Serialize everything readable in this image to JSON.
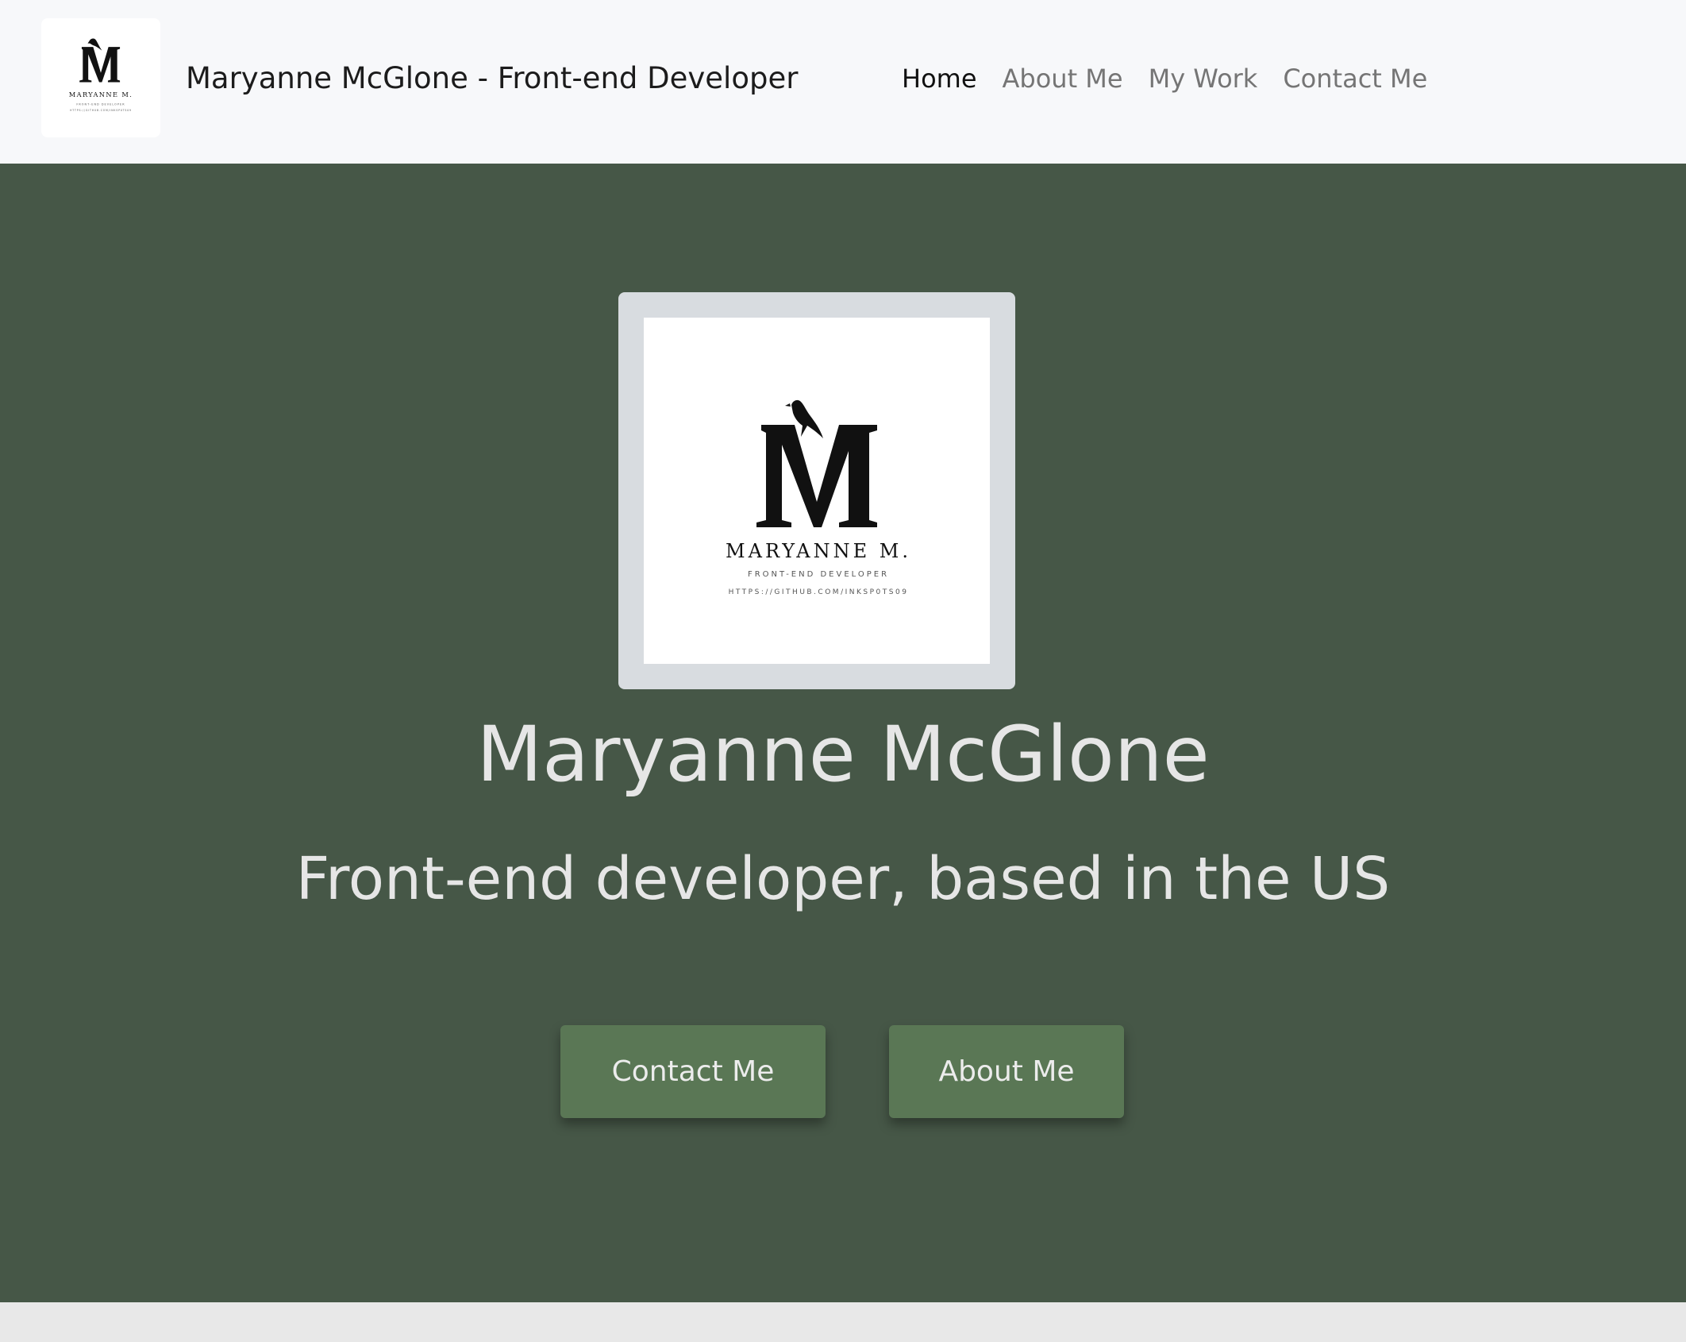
{
  "navbar": {
    "brand": "Maryanne McGlone - Front-end Developer",
    "links": [
      {
        "label": "Home",
        "active": true
      },
      {
        "label": "About Me",
        "active": false
      },
      {
        "label": "My Work",
        "active": false
      },
      {
        "label": "Contact Me",
        "active": false
      }
    ]
  },
  "logo": {
    "name": "MARYANNE M.",
    "subtitle": "FRONT-END DEVELOPER",
    "url": "HTTPS://GITHUB.COM/INKSP0TS09"
  },
  "hero": {
    "name": "Maryanne McGlone",
    "tagline": "Front-end developer, based in the US",
    "buttons": {
      "contact": "Contact Me",
      "about": "About Me"
    }
  },
  "colors": {
    "hero_bg": "#465747",
    "button_bg": "#5a7755",
    "navbar_bg": "#f7f8fa"
  },
  "icons": [
    "bird-m-logo-icon"
  ]
}
